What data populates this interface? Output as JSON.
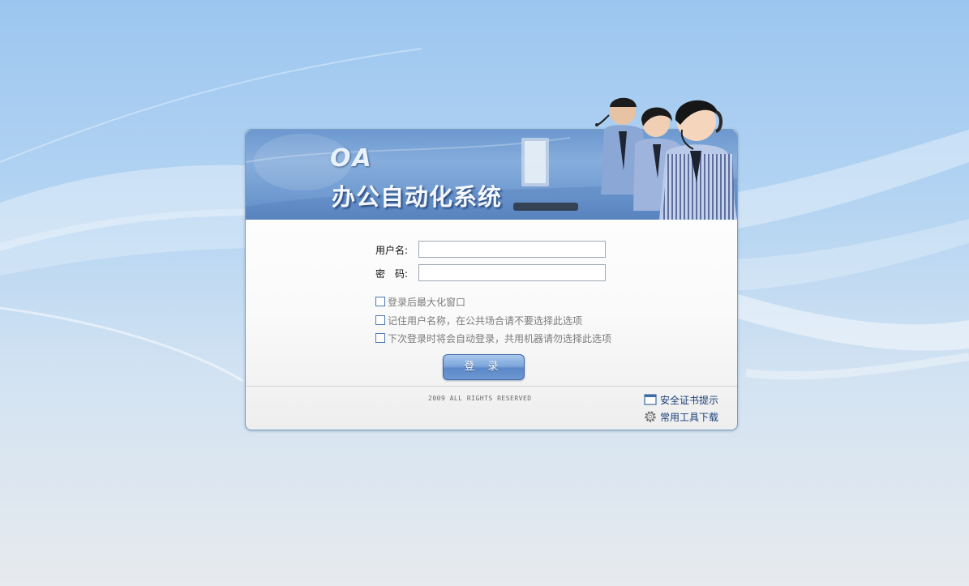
{
  "banner": {
    "oa_text": "OA",
    "title": "办公自动化系统"
  },
  "form": {
    "username_label": "用户名:",
    "username_value": "",
    "password_label": "密　码:",
    "password_value": ""
  },
  "options": [
    {
      "label": "登录后最大化窗口",
      "checked": false
    },
    {
      "label": "记住用户名称，在公共场合请不要选择此选项",
      "checked": false
    },
    {
      "label": "下次登录时将会自动登录，共用机器请勿选择此选项",
      "checked": false
    }
  ],
  "login_button": "登 录",
  "footer": {
    "copyright": "2009 ALL RIGHTS RESERVED",
    "links": [
      {
        "label": "安全证书提示",
        "icon": "window-icon"
      },
      {
        "label": "常用工具下载",
        "icon": "gear-icon"
      }
    ]
  },
  "colors": {
    "accent": "#5b88c8",
    "link": "#1b3f7a"
  }
}
